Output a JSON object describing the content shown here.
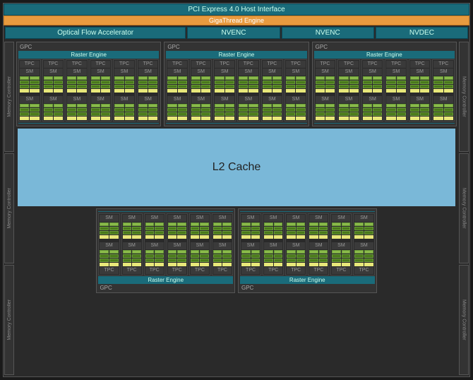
{
  "pci": "PCI Express 4.0 Host Interface",
  "giga": "GigaThread Engine",
  "ofa": "Optical Flow Accelerator",
  "engines": [
    "NVENC",
    "NVENC",
    "NVDEC"
  ],
  "mem_ctrl": "Memory Controller",
  "gpc_label": "GPC",
  "raster": "Raster Engine",
  "tpc_label": "TPC",
  "sm_label": "SM",
  "l2": "L2 Cache",
  "top_gpc_count": 3,
  "bottom_gpc_count": 2,
  "tpcs_per_gpc": 6,
  "left_mem_controllers": 3,
  "right_mem_controllers": 3
}
